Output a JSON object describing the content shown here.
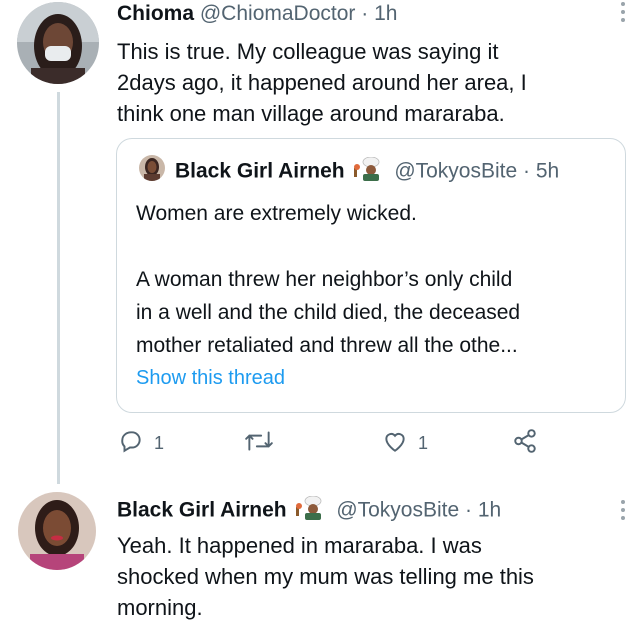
{
  "tweet1": {
    "name": "Chioma",
    "handle": "@ChiomaDoctor",
    "separator": "·",
    "time": "1h",
    "text_lines": [
      "This is true. My colleague was saying it",
      "2days ago, it happened around her area, I",
      "think one man village around mararaba."
    ]
  },
  "quote": {
    "name": "Black Girl Airneh",
    "handle": "@TokyosBite",
    "separator": "·",
    "time": "5h",
    "line1": "Women are extremely wicked.",
    "lines": [
      "A woman threw her neighbor’s only child",
      "in a well and the child died, the deceased",
      "mother retaliated and threw all the othe..."
    ],
    "show_thread": "Show this thread"
  },
  "actions": {
    "reply_count": "1",
    "like_count": "1"
  },
  "tweet2": {
    "name": "Black Girl Airneh",
    "handle": "@TokyosBite",
    "separator": "·",
    "time": "1h",
    "text_lines": [
      "Yeah. It happened in mararaba. I was",
      "shocked when my mum was telling me this",
      "morning."
    ]
  },
  "icons": {
    "reply": "reply-icon",
    "retweet": "retweet-icon",
    "like": "like-icon",
    "share": "share-icon",
    "more": "more-icon",
    "chef": "chef-emoji-icon"
  },
  "colors": {
    "link": "#1d9bf0",
    "muted": "#536471",
    "border": "#cfd9de",
    "text": "#0f1419"
  }
}
